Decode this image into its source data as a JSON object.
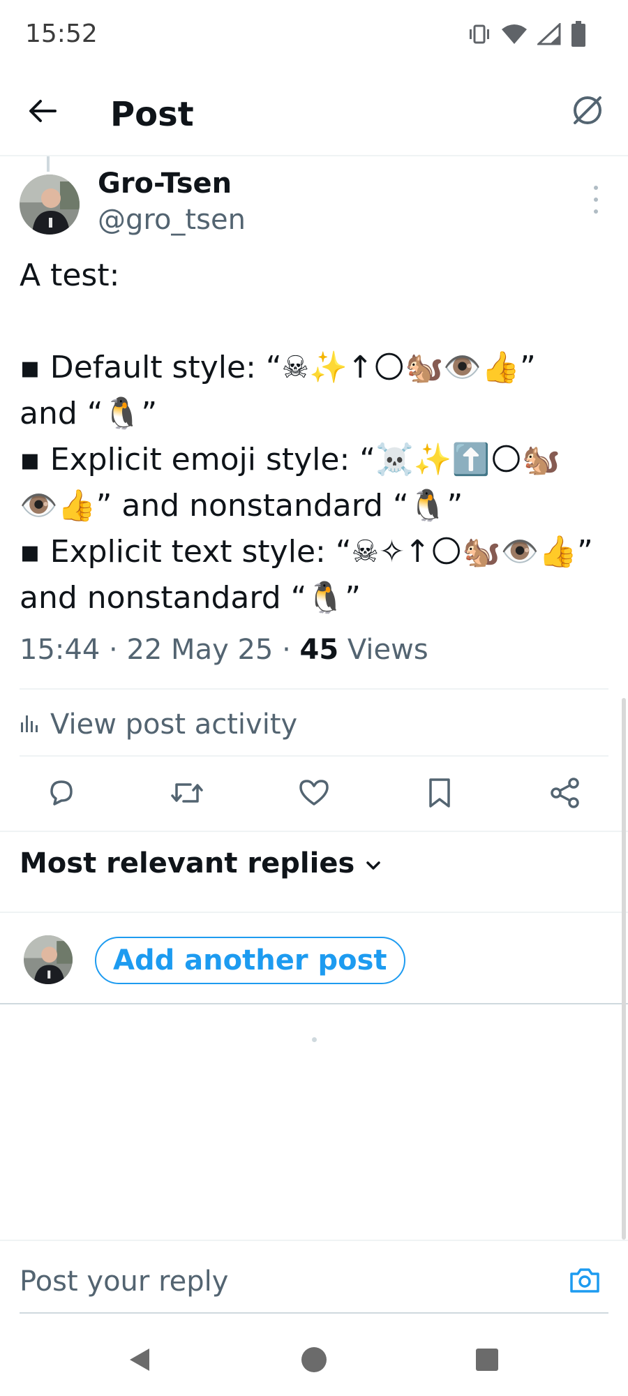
{
  "status_bar": {
    "time": "15:52",
    "icons": [
      "vibrate-icon",
      "wifi-icon",
      "signal-icon",
      "battery-icon"
    ]
  },
  "header": {
    "title": "Post",
    "back_icon": "arrow-left-icon",
    "right_icon": "spam-filter-icon"
  },
  "post": {
    "author_name": "Gro-Tsen",
    "author_handle": "@gro_tsen",
    "text_lines": [
      "A test:",
      "",
      "▪ Default style: “☠︎✨↑🌕🐿️👁️👍”",
      "and “🐧”",
      "▪ Explicit emoji style: “☠️✨⬆️🌕🐿️",
      "👁️👍” and nonstandard “🐧”",
      "▪ Explicit text style: “☠︎✧↑🌕🐿️👁️👍”",
      "and nonstandard “🐧”"
    ],
    "time": "15:44",
    "date": "22 May 25",
    "separator": "·",
    "views_count": "45",
    "views_label": "Views"
  },
  "activity": {
    "label": "View post activity",
    "icon": "bar-chart-icon"
  },
  "actions": [
    "reply-icon",
    "repost-icon",
    "like-icon",
    "bookmark-icon",
    "share-icon"
  ],
  "replies": {
    "sort_label": "Most relevant replies",
    "sort_icon": "chevron-down-icon"
  },
  "compose": {
    "add_post_label": "Add another post",
    "reply_placeholder": "Post your reply",
    "camera_icon": "camera-icon"
  },
  "colors": {
    "accent": "#1d9bf0",
    "text_primary": "#0f1419",
    "text_secondary": "#536471",
    "divider": "#eff3f4"
  },
  "nav_bar": {
    "buttons": [
      "back-triangle-icon",
      "home-circle-icon",
      "recents-square-icon"
    ]
  }
}
